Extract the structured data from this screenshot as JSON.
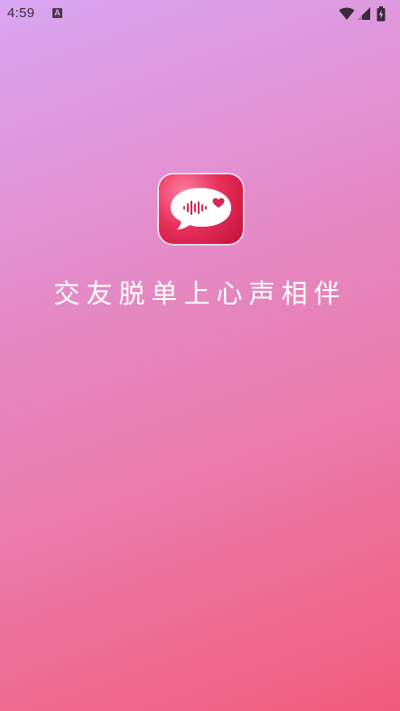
{
  "status_bar": {
    "time": "4:59",
    "notification_icon": "a-letter-icon",
    "notification_letter": "A",
    "wifi_icon": "wifi-icon",
    "signal_icon": "cell-signal-icon",
    "battery_icon": "battery-charging-icon"
  },
  "splash": {
    "app_icon": "voice-chat-heart-icon",
    "slogan": "交友脱单上心声相伴"
  },
  "colors": {
    "gradient_start": "#d9a6f2",
    "gradient_mid": "#ea7aa8",
    "gradient_end": "#f15c7d",
    "icon_red": "#e8305a",
    "text": "#ffffff"
  }
}
